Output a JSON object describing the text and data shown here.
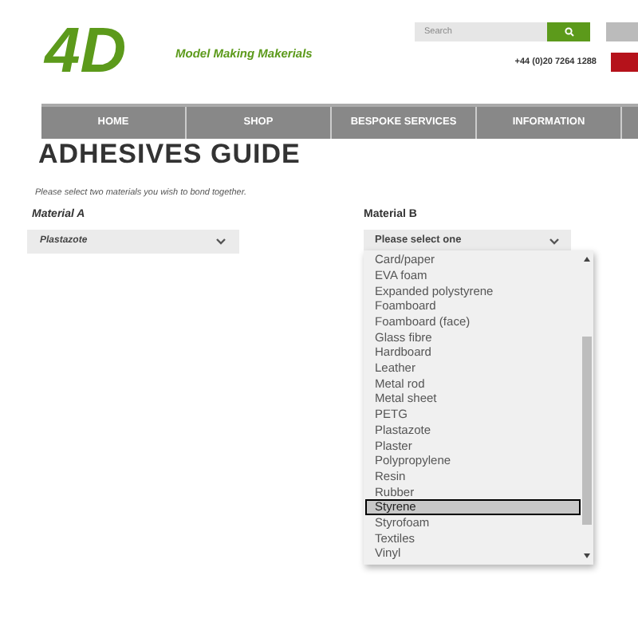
{
  "logo": {
    "mark": "4D",
    "tagline": "Model Making Makerials"
  },
  "search": {
    "placeholder": "Search"
  },
  "phone": "+44 (0)20 7264 1288",
  "nav": [
    {
      "label": "HOME"
    },
    {
      "label": "SHOP"
    },
    {
      "label": "BESPOKE SERVICES"
    },
    {
      "label": "INFORMATION"
    }
  ],
  "title": "ADHESIVES GUIDE",
  "instruction": "Please select two materials you wish to bond together.",
  "material_a": {
    "label": "Material A",
    "value": "Plastazote"
  },
  "material_b": {
    "label": "Material B",
    "value": "Please select one",
    "expanded": true,
    "options": [
      {
        "label": "Card/paper",
        "selected": false
      },
      {
        "label": "EVA foam",
        "selected": false
      },
      {
        "label": "Expanded polystyrene",
        "selected": false
      },
      {
        "label": "Foamboard",
        "selected": false
      },
      {
        "label": "Foamboard (face)",
        "selected": false
      },
      {
        "label": "Glass fibre",
        "selected": false
      },
      {
        "label": "Hardboard",
        "selected": false
      },
      {
        "label": "Leather",
        "selected": false
      },
      {
        "label": "Metal rod",
        "selected": false
      },
      {
        "label": "Metal sheet",
        "selected": false
      },
      {
        "label": "PETG",
        "selected": false
      },
      {
        "label": "Plastazote",
        "selected": false
      },
      {
        "label": "Plaster",
        "selected": false
      },
      {
        "label": "Polypropylene",
        "selected": false
      },
      {
        "label": "Resin",
        "selected": false
      },
      {
        "label": "Rubber",
        "selected": false
      },
      {
        "label": "Styrene",
        "selected": true
      },
      {
        "label": "Styrofoam",
        "selected": false
      },
      {
        "label": "Textiles",
        "selected": false
      },
      {
        "label": "Vinyl",
        "selected": false
      }
    ]
  }
}
